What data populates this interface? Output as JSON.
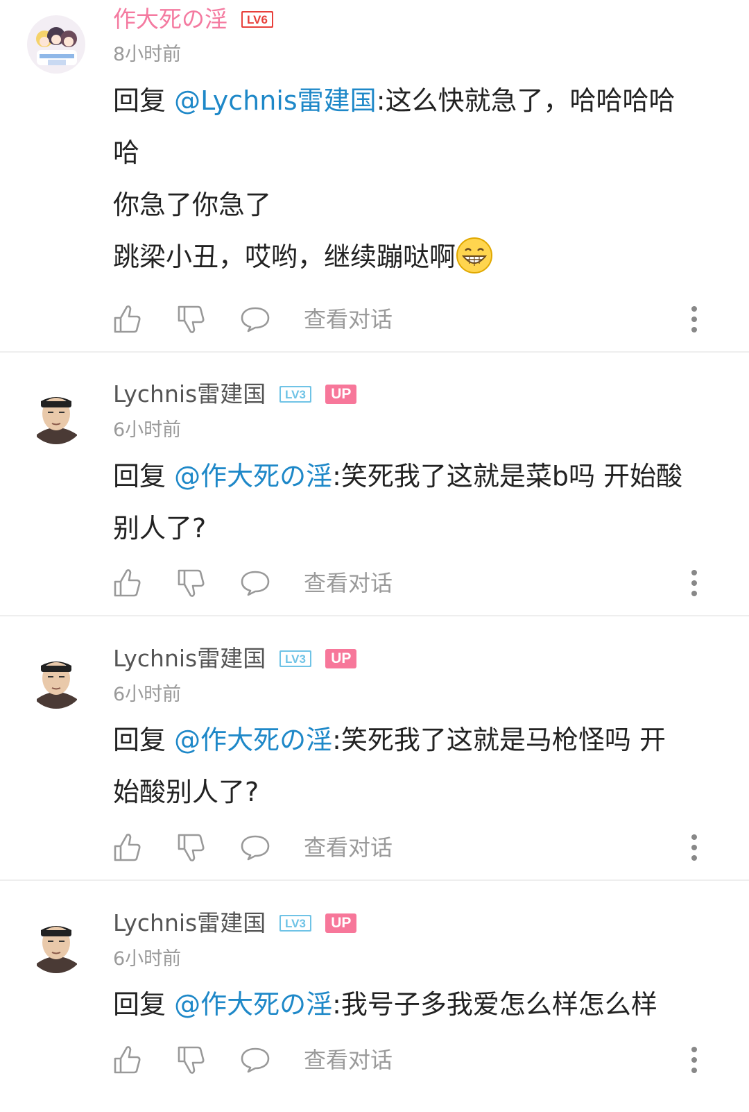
{
  "comments": [
    {
      "username": "作大死の淫",
      "level": "LV6",
      "up": "",
      "time": "8小时前",
      "reply_prefix": "回复 ",
      "mention": "@Lychnis雷建国",
      "lines": [
        ":这么快就急了，哈哈哈哈",
        "哈",
        "你急了你急了",
        "跳梁小丑，哎哟，继续蹦哒啊"
      ],
      "view_conversation": "查看对话"
    },
    {
      "username": "Lychnis雷建国",
      "level": "LV3",
      "up": "UP",
      "time": "6小时前",
      "reply_prefix": "回复 ",
      "mention": "@作大死の淫",
      "lines": [
        ":笑死我了这就是菜b吗 开始酸",
        "别人了?"
      ],
      "view_conversation": "查看对话"
    },
    {
      "username": "Lychnis雷建国",
      "level": "LV3",
      "up": "UP",
      "time": "6小时前",
      "reply_prefix": "回复 ",
      "mention": "@作大死の淫",
      "lines": [
        ":笑死我了这就是马枪怪吗 开",
        "始酸别人了?"
      ],
      "view_conversation": "查看对话"
    },
    {
      "username": "Lychnis雷建国",
      "level": "LV3",
      "up": "UP",
      "time": "6小时前",
      "reply_prefix": "回复 ",
      "mention": "@作大死の淫",
      "lines": [
        ":我号子多我爱怎么样怎么样"
      ],
      "view_conversation": "查看对话"
    }
  ],
  "icons": {
    "like": "thumbs-up-icon",
    "dislike": "thumbs-down-icon",
    "reply": "speech-bubble-icon",
    "more": "vertical-dots-icon",
    "emoji": "grinning-face-emoji"
  },
  "colors": {
    "mention": "#1e88c8",
    "vip_name": "#f47aa0",
    "up_badge": "#f7779a",
    "lv6_badge": "#e8403b",
    "lv3_badge": "#6fc3e6"
  }
}
